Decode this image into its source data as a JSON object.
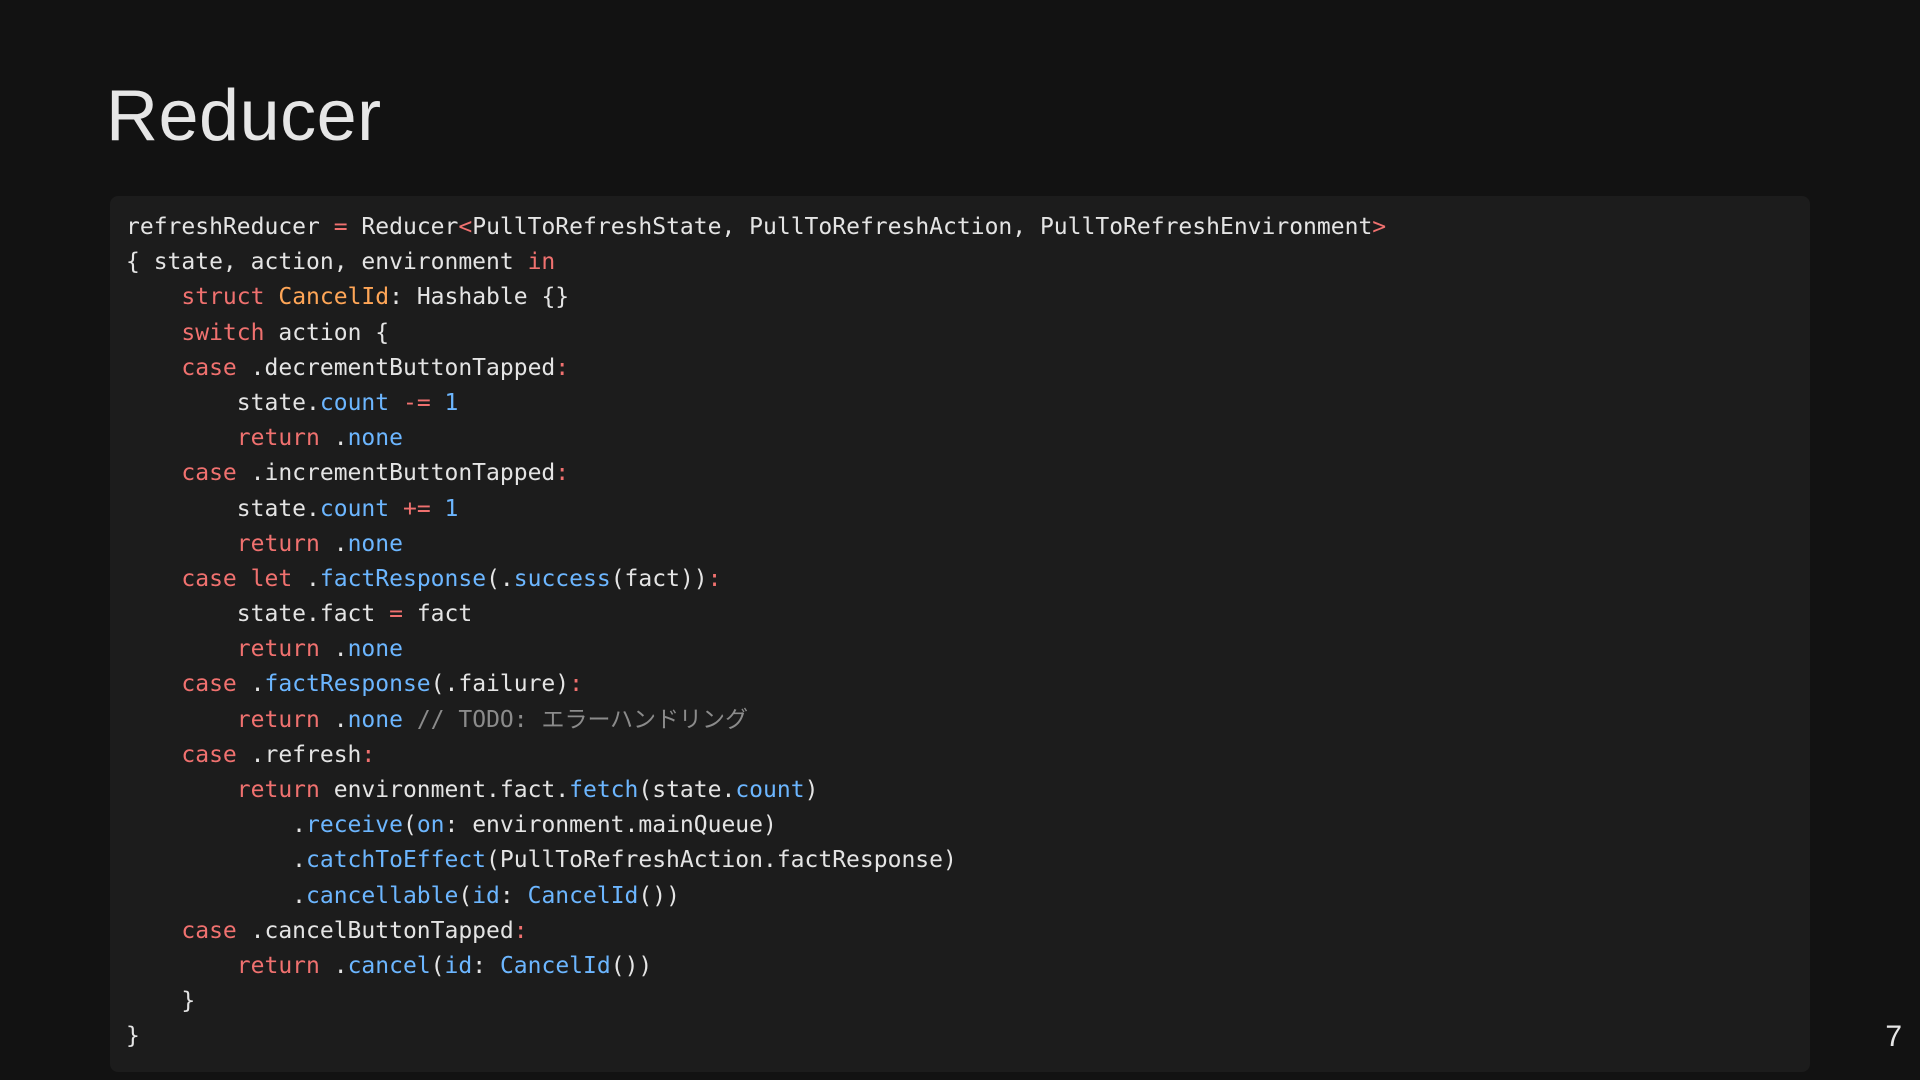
{
  "slide": {
    "title": "Reducer",
    "page_number": "7"
  },
  "code": {
    "language": "swift",
    "colors": {
      "background": "#121212",
      "code_background": "#1c1c1c",
      "plain": "#e4e4e4",
      "keyword": "#f0716f",
      "type": "#ffa657",
      "function": "#6cb6ff",
      "comment": "#8b8b8b"
    },
    "lines": [
      [
        [
          "p",
          "refreshReducer "
        ],
        [
          "k",
          "="
        ],
        [
          "p",
          " Reducer"
        ],
        [
          "k",
          "<"
        ],
        [
          "p",
          "PullToRefreshState, PullToRefreshAction, PullToRefreshEnvironment"
        ],
        [
          "k",
          ">"
        ]
      ],
      [
        [
          "p",
          "{ state, action, environment "
        ],
        [
          "k",
          "in"
        ]
      ],
      [
        [
          "p",
          "    "
        ],
        [
          "k",
          "struct"
        ],
        [
          "p",
          " "
        ],
        [
          "t",
          "CancelId"
        ],
        [
          "p",
          ": Hashable {}"
        ]
      ],
      [
        [
          "p",
          "    "
        ],
        [
          "k",
          "switch"
        ],
        [
          "p",
          " action {"
        ]
      ],
      [
        [
          "p",
          "    "
        ],
        [
          "k",
          "case"
        ],
        [
          "p",
          " .decrementButtonTapped"
        ],
        [
          "k",
          ":"
        ]
      ],
      [
        [
          "p",
          "        state."
        ],
        [
          "f",
          "count"
        ],
        [
          "p",
          " "
        ],
        [
          "k",
          "-="
        ],
        [
          "p",
          " "
        ],
        [
          "f",
          "1"
        ]
      ],
      [
        [
          "p",
          "        "
        ],
        [
          "k",
          "return"
        ],
        [
          "p",
          " ."
        ],
        [
          "f",
          "none"
        ]
      ],
      [
        [
          "p",
          "    "
        ],
        [
          "k",
          "case"
        ],
        [
          "p",
          " .incrementButtonTapped"
        ],
        [
          "k",
          ":"
        ]
      ],
      [
        [
          "p",
          "        state."
        ],
        [
          "f",
          "count"
        ],
        [
          "p",
          " "
        ],
        [
          "k",
          "+="
        ],
        [
          "p",
          " "
        ],
        [
          "f",
          "1"
        ]
      ],
      [
        [
          "p",
          "        "
        ],
        [
          "k",
          "return"
        ],
        [
          "p",
          " ."
        ],
        [
          "f",
          "none"
        ]
      ],
      [
        [
          "p",
          "    "
        ],
        [
          "k",
          "case"
        ],
        [
          "p",
          " "
        ],
        [
          "k",
          "let"
        ],
        [
          "p",
          " ."
        ],
        [
          "f",
          "factResponse"
        ],
        [
          "p",
          "(."
        ],
        [
          "f",
          "success"
        ],
        [
          "p",
          "(fact))"
        ],
        [
          "k",
          ":"
        ]
      ],
      [
        [
          "p",
          "        state.fact "
        ],
        [
          "k",
          "="
        ],
        [
          "p",
          " fact"
        ]
      ],
      [
        [
          "p",
          "        "
        ],
        [
          "k",
          "return"
        ],
        [
          "p",
          " ."
        ],
        [
          "f",
          "none"
        ]
      ],
      [
        [
          "p",
          "    "
        ],
        [
          "k",
          "case"
        ],
        [
          "p",
          " ."
        ],
        [
          "f",
          "factResponse"
        ],
        [
          "p",
          "(.failure)"
        ],
        [
          "k",
          ":"
        ]
      ],
      [
        [
          "p",
          "        "
        ],
        [
          "k",
          "return"
        ],
        [
          "p",
          " ."
        ],
        [
          "f",
          "none"
        ],
        [
          "p",
          " "
        ],
        [
          "c",
          "// TODO: エラーハンドリング"
        ]
      ],
      [
        [
          "p",
          "    "
        ],
        [
          "k",
          "case"
        ],
        [
          "p",
          " .refresh"
        ],
        [
          "k",
          ":"
        ]
      ],
      [
        [
          "p",
          "        "
        ],
        [
          "k",
          "return"
        ],
        [
          "p",
          " environment.fact."
        ],
        [
          "f",
          "fetch"
        ],
        [
          "p",
          "(state."
        ],
        [
          "f",
          "count"
        ],
        [
          "p",
          ")"
        ]
      ],
      [
        [
          "p",
          "            ."
        ],
        [
          "f",
          "receive"
        ],
        [
          "p",
          "("
        ],
        [
          "f",
          "on"
        ],
        [
          "p",
          ": environment.mainQueue)"
        ]
      ],
      [
        [
          "p",
          "            ."
        ],
        [
          "f",
          "catchToEffect"
        ],
        [
          "p",
          "(PullToRefreshAction.factResponse)"
        ]
      ],
      [
        [
          "p",
          "            ."
        ],
        [
          "f",
          "cancellable"
        ],
        [
          "p",
          "("
        ],
        [
          "f",
          "id"
        ],
        [
          "p",
          ": "
        ],
        [
          "f",
          "CancelId"
        ],
        [
          "p",
          "())"
        ]
      ],
      [
        [
          "p",
          "    "
        ],
        [
          "k",
          "case"
        ],
        [
          "p",
          " .cancelButtonTapped"
        ],
        [
          "k",
          ":"
        ]
      ],
      [
        [
          "p",
          "        "
        ],
        [
          "k",
          "return"
        ],
        [
          "p",
          " ."
        ],
        [
          "f",
          "cancel"
        ],
        [
          "p",
          "("
        ],
        [
          "f",
          "id"
        ],
        [
          "p",
          ": "
        ],
        [
          "f",
          "CancelId"
        ],
        [
          "p",
          "())"
        ]
      ],
      [
        [
          "p",
          "    }"
        ]
      ],
      [
        [
          "p",
          "}"
        ]
      ]
    ]
  }
}
